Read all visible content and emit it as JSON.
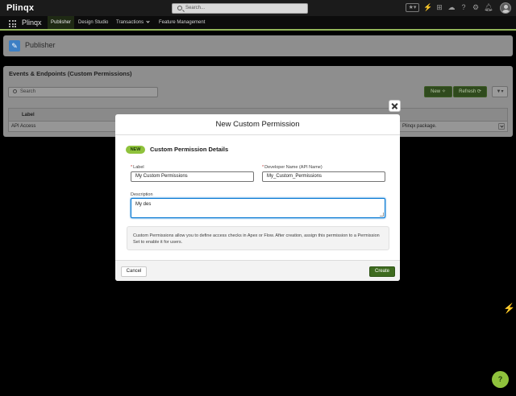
{
  "header": {
    "logo": "Plinqx",
    "search_placeholder": "Search...",
    "icons": [
      "favorites-star-icon",
      "lightning-icon",
      "add-icon",
      "cloud-icon",
      "help-icon",
      "settings-icon",
      "notifications-bell-icon"
    ]
  },
  "nav": {
    "app_name": "Plinqx",
    "items": [
      "Publisher",
      "Design Studio",
      "Transactions",
      "Feature Management"
    ],
    "active": "Publisher",
    "accent": "#93b55a"
  },
  "page": {
    "title": "Publisher"
  },
  "list": {
    "title": "Events & Endpoints (Custom Permissions)",
    "search_placeholder": "Search",
    "new_label": "New",
    "refresh_label": "Refresh",
    "columns": [
      "Label"
    ],
    "rows": [
      {
        "label": "API Access",
        "description": "Plinqx package."
      }
    ]
  },
  "modal": {
    "title": "New Custom Permission",
    "badge": "NEW",
    "section_title": "Custom Permission Details",
    "label_field": {
      "label": "Label",
      "required": "*",
      "value": "My Custom Permissions"
    },
    "dev_name_field": {
      "label": "Developer Name (API Name)",
      "required": "*",
      "value": "My_Custom_Permissions"
    },
    "description_field": {
      "label": "Description",
      "value": "My des"
    },
    "info_text": "Custom Permissions allow you to define access checks in Apex or Flow. After creation, assign this permission to a Permission Set to enable it for users.",
    "cancel_label": "Cancel",
    "create_label": "Create",
    "primary_color": "#3e6b1f"
  },
  "help_fab": {
    "label": "?",
    "color": "#8fc23c"
  }
}
